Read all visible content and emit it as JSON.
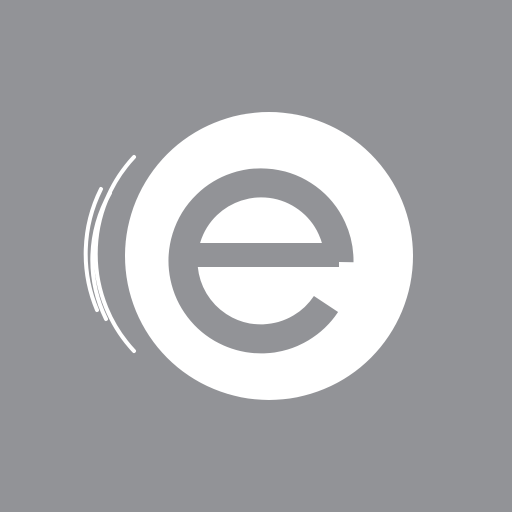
{
  "icon": {
    "background_color": "#929397",
    "disc_color": "#FFFFFF",
    "letter_color": "#929397",
    "logo_letter": "e",
    "logo_icon_name": "lowercase-e-motion-logo"
  }
}
